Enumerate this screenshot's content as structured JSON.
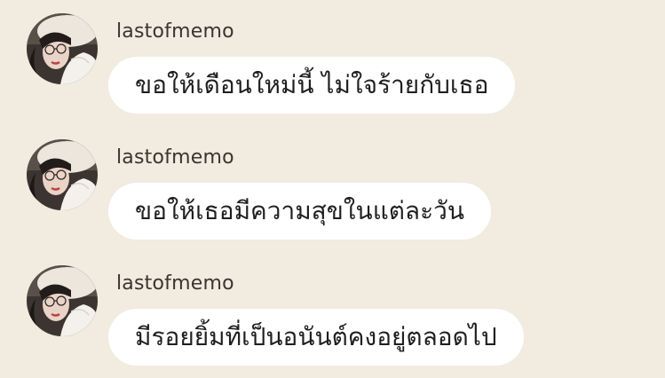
{
  "messages": [
    {
      "username": "lastofmemo",
      "text": "ขอให้เดือนใหม่นี้ ไม่ใจร้ายกับเธอ"
    },
    {
      "username": "lastofmemo",
      "text": "ขอให้เธอมีความสุขในแต่ละวัน"
    },
    {
      "username": "lastofmemo",
      "text": "มีรอยยิ้มที่เป็นอนันต์คงอยู่ตลอดไป"
    }
  ],
  "colors": {
    "background": "#f1ebe0",
    "bubble": "#ffffff",
    "text": "#1f1f1f",
    "username": "#3a3530"
  }
}
